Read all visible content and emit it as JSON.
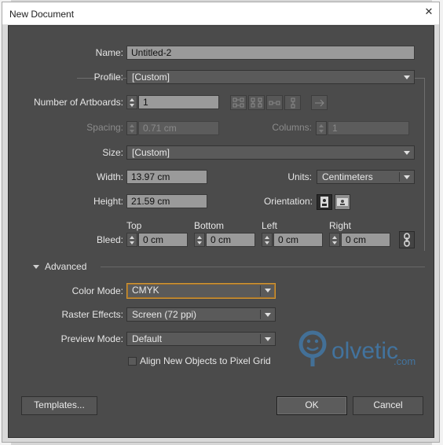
{
  "window": {
    "title": "New Document"
  },
  "name": {
    "label": "Name:",
    "value": "Untitled-2"
  },
  "profile": {
    "label": "Profile:",
    "value": "[Custom]"
  },
  "artboards": {
    "label": "Number of Artboards:",
    "value": "1"
  },
  "spacing": {
    "label": "Spacing:",
    "value": "0.71 cm"
  },
  "columns": {
    "label": "Columns:",
    "value": "1"
  },
  "size": {
    "label": "Size:",
    "value": "[Custom]"
  },
  "width": {
    "label": "Width:",
    "value": "13.97 cm"
  },
  "units": {
    "label": "Units:",
    "value": "Centimeters"
  },
  "height": {
    "label": "Height:",
    "value": "21.59 cm"
  },
  "orientation": {
    "label": "Orientation:"
  },
  "bleed": {
    "label": "Bleed:",
    "top_label": "Top",
    "top_value": "0 cm",
    "bottom_label": "Bottom",
    "bottom_value": "0 cm",
    "left_label": "Left",
    "left_value": "0 cm",
    "right_label": "Right",
    "right_value": "0 cm"
  },
  "advanced": {
    "label": "Advanced"
  },
  "color_mode": {
    "label": "Color Mode:",
    "value": "CMYK"
  },
  "raster_effects": {
    "label": "Raster Effects:",
    "value": "Screen (72 ppi)"
  },
  "preview_mode": {
    "label": "Preview Mode:",
    "value": "Default"
  },
  "align_pixel_grid": {
    "label": "Align New Objects to Pixel Grid",
    "checked": false
  },
  "buttons": {
    "templates": "Templates...",
    "ok": "OK",
    "cancel": "Cancel"
  },
  "watermark": {
    "text": "olvetic",
    "suffix": ".com"
  },
  "colors": {
    "dialog_bg": "#4b4b4b",
    "focus_ring": "#d39733",
    "watermark_blue": "#3d8fd6"
  }
}
